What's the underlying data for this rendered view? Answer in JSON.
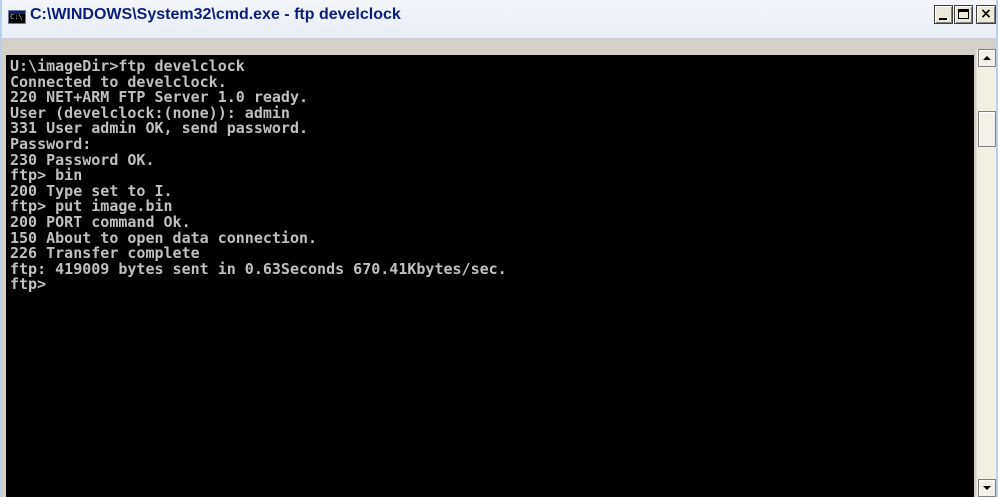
{
  "window": {
    "title": "C:\\WINDOWS\\System32\\cmd.exe - ftp develclock",
    "icon": "command-prompt-icon",
    "icon_label": "C:\\"
  },
  "console": {
    "background": "#000000",
    "foreground": "#c0c0c0",
    "lines": [
      "U:\\imageDir>ftp develclock",
      "Connected to develclock.",
      "220 NET+ARM FTP Server 1.0 ready.",
      "User (develclock:(none)): admin",
      "331 User admin OK, send password.",
      "Password:",
      "230 Password OK.",
      "ftp> bin",
      "200 Type set to I.",
      "ftp> put image.bin",
      "200 PORT command Ok.",
      "150 About to open data connection.",
      "226 Transfer complete",
      "ftp: 419009 bytes sent in 0.63Seconds 670.41Kbytes/sec.",
      "ftp>"
    ]
  },
  "caption_buttons": {
    "minimize": "minimize-icon",
    "maximize": "maximize-icon",
    "close": "close-icon",
    "close_glyph": "×"
  }
}
